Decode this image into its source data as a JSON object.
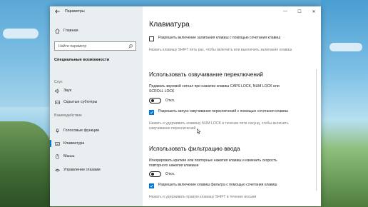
{
  "window": {
    "title": "Параметры",
    "controls": {
      "minimize": "—",
      "maximize": "☐",
      "close": "✕"
    }
  },
  "sidebar": {
    "home_label": "Главная",
    "search_placeholder": "Найти параметр",
    "section_title": "Специальные возможности",
    "groups": [
      {
        "label": "Слух",
        "items": [
          "Звук",
          "Скрытые субтитры"
        ]
      },
      {
        "label": "Взаимодействие",
        "items": [
          "Голосовые функции",
          "Клавиатура",
          "Мышь",
          "Управление глазами"
        ]
      }
    ],
    "active_item": "Клавиатура"
  },
  "main": {
    "page_title": "Клавиатура",
    "sticky": {
      "checkbox_label": "Разрешить включение залипания клавиш с помощью сочетания клавиш",
      "checked": false,
      "description": "Нажать клавишу SHIFT пять раз, чтобы включить или выключить залипание клавиш"
    },
    "toggle_keys": {
      "heading": "Использовать озвучивание переключений",
      "description": "Подавать звуковой сигнал при нажатии клавиш CAPS LOCK, NUM LOCK или SCROLL LOCK",
      "toggle_label": "Откл.",
      "toggle_on": false,
      "checkbox_label": "Разрешить запуск озвучивания переключений с помощью сочетания клавиш",
      "checked": true,
      "hint": "Нажать и удерживать клавишу NUM LOCK в течение пяти секунд, чтобы включить озвучивание переключений"
    },
    "filter_keys": {
      "heading": "Использовать фильтрацию ввода",
      "description": "Игнорировать краткие или повторные нажатия клавиш и изменить скорость повторного нажатия клавиши",
      "toggle_label": "Откл.",
      "toggle_on": false,
      "checkbox_label": "Разрешить включение клавиш фильтра с помощью сочетания клавиш",
      "checked": true,
      "hint": "Нажать и удерживать правую клавишу SHIFT в течение восьми"
    }
  },
  "colors": {
    "accent": "#0078d7",
    "sidebar_bg": "#e8eef0"
  }
}
